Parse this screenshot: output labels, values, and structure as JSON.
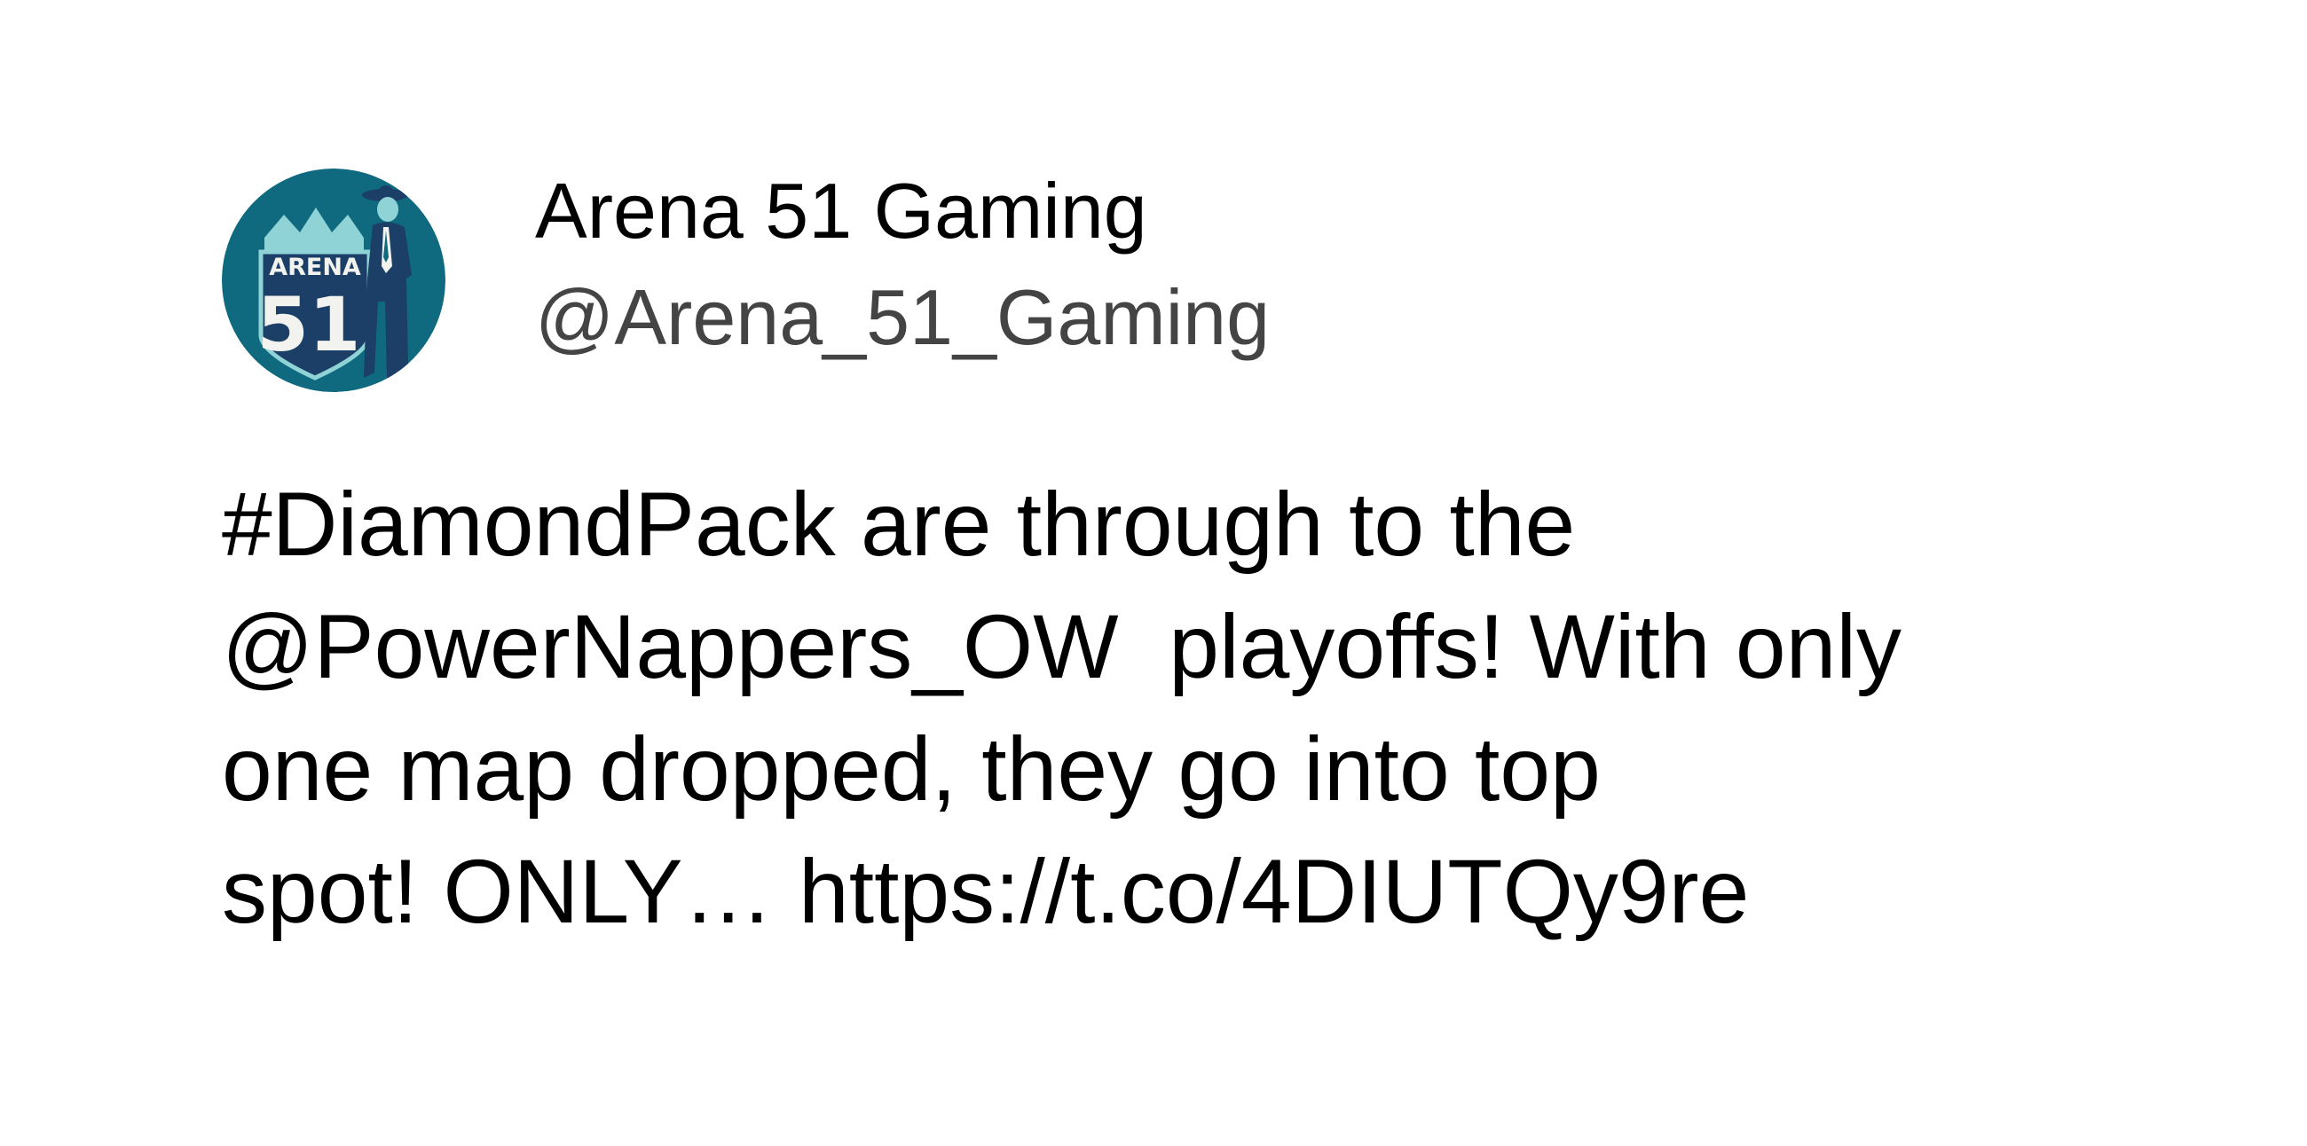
{
  "tweet": {
    "author": {
      "display_name": "Arena 51 Gaming",
      "handle": "@Arena_51_Gaming",
      "avatar": {
        "icon": "arena-51-logo-icon",
        "badge_text": "ARENA",
        "badge_number": "51",
        "colors": {
          "background": "#0f6a80",
          "shield": "#1b3f66",
          "accent": "#8fd3d6",
          "text": "#f2f2ee"
        }
      }
    },
    "text_lines": [
      "#DiamondPack are through to the",
      "@PowerNappers_OW  playoffs! With only",
      "one map dropped, they go into top",
      "spot! ONLY… https://t.co/4DIUTQy9re"
    ]
  }
}
